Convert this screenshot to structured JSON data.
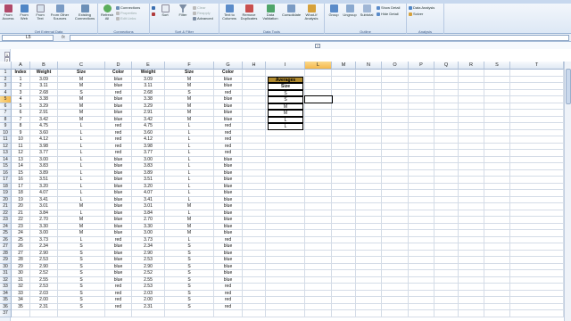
{
  "ribbon": {
    "tabs_hint": "Page Layout   Formulas   Data   Review   View",
    "groups": {
      "external_data": {
        "caption": "Get External Data",
        "buttons": [
          "From Access",
          "From Web",
          "From Text",
          "From Other Sources",
          "Existing Connections"
        ]
      },
      "connections": {
        "caption": "Connections",
        "refresh": "Refresh All",
        "small": [
          "Connections",
          "Properties",
          "Edit Links"
        ]
      },
      "sort_filter": {
        "caption": "Sort & Filter",
        "sort": "Sort",
        "filter": "Filter",
        "small": [
          "Clear",
          "Reapply",
          "Advanced"
        ]
      },
      "data_tools": {
        "caption": "Data Tools",
        "buttons": [
          "Text to Columns",
          "Remove Duplicates",
          "Data Validation",
          "Consolidate",
          "What-If Analysis"
        ]
      },
      "outline": {
        "caption": "Outline",
        "buttons": [
          "Group",
          "Ungroup",
          "Subtotal"
        ],
        "small": [
          "Show Detail",
          "Hide Detail"
        ]
      },
      "analysis": {
        "caption": "Analysis",
        "small": [
          "Data Analysis",
          "Solver"
        ]
      }
    }
  },
  "formula_bar": {
    "name_box": "L5",
    "fx": "fx",
    "formula": ""
  },
  "sheet": {
    "columns": [
      "A",
      "B",
      "C",
      "D",
      "E",
      "F",
      "G",
      "H",
      "I",
      "L",
      "M",
      "N",
      "O",
      "P",
      "Q",
      "R",
      "S",
      "T"
    ],
    "selected_column": "L",
    "selected_row": 5,
    "rows": [
      [
        "Index",
        "Weight",
        "Size",
        "Color",
        "Weight",
        "Size",
        "Color"
      ],
      [
        "1",
        "3.09",
        "M",
        "blue",
        "3.09",
        "M",
        "blue"
      ],
      [
        "2",
        "3.11",
        "M",
        "blue",
        "3.11",
        "M",
        "blue"
      ],
      [
        "3",
        "2.68",
        "S",
        "red",
        "2.68",
        "S",
        "red"
      ],
      [
        "4",
        "3.38",
        "M",
        "blue",
        "3.38",
        "M",
        "blue"
      ],
      [
        "5",
        "3.29",
        "M",
        "blue",
        "3.29",
        "M",
        "blue"
      ],
      [
        "6",
        "2.91",
        "M",
        "blue",
        "2.91",
        "M",
        "blue"
      ],
      [
        "7",
        "3.42",
        "M",
        "blue",
        "3.42",
        "M",
        "blue"
      ],
      [
        "8",
        "4.75",
        "L",
        "red",
        "4.75",
        "L",
        "red"
      ],
      [
        "9",
        "3.60",
        "L",
        "red",
        "3.60",
        "L",
        "red"
      ],
      [
        "10",
        "4.12",
        "L",
        "red",
        "4.12",
        "L",
        "red"
      ],
      [
        "11",
        "3.98",
        "L",
        "red",
        "3.98",
        "L",
        "red"
      ],
      [
        "12",
        "3.77",
        "L",
        "red",
        "3.77",
        "L",
        "red"
      ],
      [
        "13",
        "3.00",
        "L",
        "blue",
        "3.00",
        "L",
        "blue"
      ],
      [
        "14",
        "3.83",
        "L",
        "blue",
        "3.83",
        "L",
        "blue"
      ],
      [
        "15",
        "3.89",
        "L",
        "blue",
        "3.89",
        "L",
        "blue"
      ],
      [
        "16",
        "3.51",
        "L",
        "blue",
        "3.51",
        "L",
        "blue"
      ],
      [
        "17",
        "3.20",
        "L",
        "blue",
        "3.20",
        "L",
        "blue"
      ],
      [
        "18",
        "4.07",
        "L",
        "blue",
        "4.07",
        "L",
        "blue"
      ],
      [
        "19",
        "3.41",
        "L",
        "blue",
        "3.41",
        "L",
        "blue"
      ],
      [
        "20",
        "3.01",
        "M",
        "blue",
        "3.01",
        "M",
        "blue"
      ],
      [
        "21",
        "3.84",
        "L",
        "blue",
        "3.84",
        "L",
        "blue"
      ],
      [
        "22",
        "2.70",
        "M",
        "blue",
        "2.70",
        "M",
        "blue"
      ],
      [
        "23",
        "3.30",
        "M",
        "blue",
        "3.30",
        "M",
        "blue"
      ],
      [
        "24",
        "3.00",
        "M",
        "blue",
        "3.00",
        "M",
        "blue"
      ],
      [
        "25",
        "3.73",
        "L",
        "red",
        "3.73",
        "L",
        "red"
      ],
      [
        "26",
        "2.34",
        "S",
        "blue",
        "2.34",
        "S",
        "blue"
      ],
      [
        "27",
        "2.90",
        "S",
        "blue",
        "2.90",
        "S",
        "blue"
      ],
      [
        "28",
        "2.53",
        "S",
        "blue",
        "2.53",
        "S",
        "blue"
      ],
      [
        "29",
        "2.90",
        "S",
        "blue",
        "2.90",
        "S",
        "blue"
      ],
      [
        "30",
        "2.52",
        "S",
        "blue",
        "2.52",
        "S",
        "blue"
      ],
      [
        "31",
        "2.55",
        "S",
        "blue",
        "2.55",
        "S",
        "blue"
      ],
      [
        "32",
        "2.53",
        "S",
        "red",
        "2.53",
        "S",
        "red"
      ],
      [
        "33",
        "2.03",
        "S",
        "red",
        "2.03",
        "S",
        "red"
      ],
      [
        "34",
        "2.00",
        "S",
        "red",
        "2.00",
        "S",
        "red"
      ],
      [
        "35",
        "2.31",
        "S",
        "red",
        "2.31",
        "S",
        "red"
      ]
    ],
    "averages_box": {
      "title": "Averages",
      "subtitle": "Size",
      "values": [
        "S",
        "S",
        "M",
        "M",
        "L",
        "L"
      ]
    }
  }
}
